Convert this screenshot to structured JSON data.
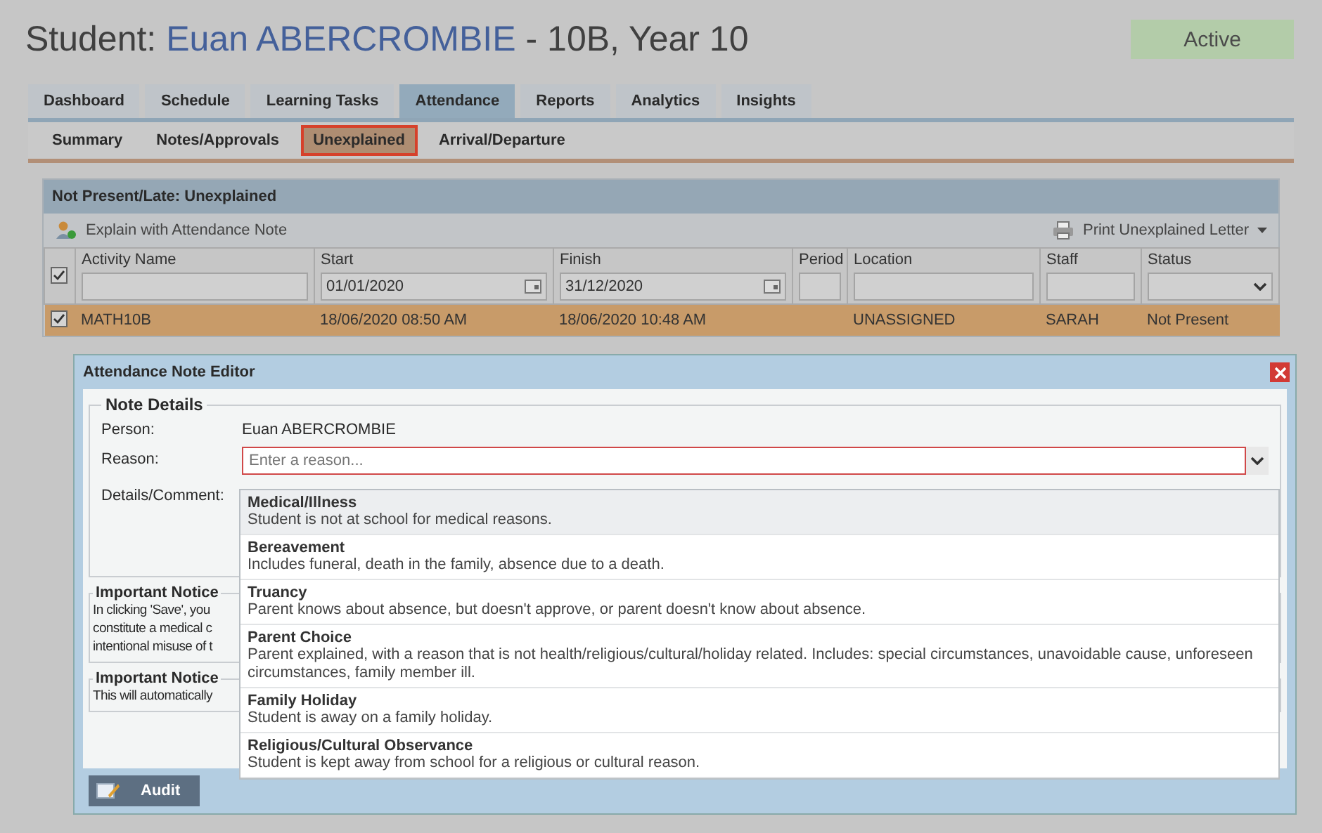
{
  "header": {
    "label": "Student:",
    "student_name": "Euan ABERCROMBIE",
    "suffix": "- 10B, Year 10",
    "status_badge": "Active"
  },
  "tabs": [
    {
      "label": "Dashboard",
      "selected": false
    },
    {
      "label": "Schedule",
      "selected": false
    },
    {
      "label": "Learning Tasks",
      "selected": false
    },
    {
      "label": "Attendance",
      "selected": true
    },
    {
      "label": "Reports",
      "selected": false
    },
    {
      "label": "Analytics",
      "selected": false
    },
    {
      "label": "Insights",
      "selected": false
    }
  ],
  "subtabs": [
    {
      "label": "Summary",
      "selected": false
    },
    {
      "label": "Notes/Approvals",
      "selected": false
    },
    {
      "label": "Unexplained",
      "selected": true
    },
    {
      "label": "Arrival/Departure",
      "selected": false
    }
  ],
  "panel": {
    "title": "Not Present/Late: Unexplained",
    "explain_button": "Explain with Attendance Note",
    "print_button": "Print Unexplained Letter",
    "select_all_checked": true,
    "columns": [
      {
        "label": "Activity Name",
        "kind": "text"
      },
      {
        "label": "Start",
        "kind": "date",
        "filter": "01/01/2020"
      },
      {
        "label": "Finish",
        "kind": "date",
        "filter": "31/12/2020"
      },
      {
        "label": "Period",
        "kind": "text"
      },
      {
        "label": "Location",
        "kind": "text"
      },
      {
        "label": "Staff",
        "kind": "text"
      },
      {
        "label": "Status",
        "kind": "select"
      }
    ],
    "rows": [
      {
        "checked": true,
        "cells": [
          "MATH10B",
          "18/06/2020 08:50 AM",
          "18/06/2020 10:48 AM",
          "",
          "UNASSIGNED",
          "SARAH",
          "Not Present"
        ]
      }
    ]
  },
  "dialog": {
    "title": "Attendance Note Editor",
    "note_details": {
      "legend": "Note Details",
      "person_label": "Person:",
      "person": "Euan ABERCROMBIE",
      "reason_label": "Reason:",
      "reason_placeholder": "Enter a reason...",
      "details_label": "Details/Comment:"
    },
    "notices": [
      {
        "legend": "Important Notice",
        "lines": [
          "In clicking 'Save', you",
          "constitute a medical c",
          "intentional misuse of t"
        ]
      },
      {
        "legend": "Important Notice",
        "lines": [
          "This will automatically"
        ]
      }
    ],
    "audit_button": "Audit",
    "reason_options": [
      {
        "title": "Medical/Illness",
        "description": "Student is not at school for medical reasons.",
        "selected": true
      },
      {
        "title": "Bereavement",
        "description": "Includes funeral, death in the family, absence due to a death.",
        "selected": false
      },
      {
        "title": "Truancy",
        "description": "Parent knows about absence, but doesn't approve, or parent doesn't know about absence.",
        "selected": false
      },
      {
        "title": "Parent Choice",
        "description": "Parent explained, with a reason that is not health/religious/cultural/holiday related. Includes: special circumstances, unavoidable cause, unforeseen circumstances, family member ill.",
        "selected": false
      },
      {
        "title": "Family Holiday",
        "description": "Student is away on a family holiday.",
        "selected": false
      },
      {
        "title": "Religious/Cultural Observance",
        "description": "Student is kept away from school for a religious or cultural reason.",
        "selected": false
      }
    ]
  }
}
